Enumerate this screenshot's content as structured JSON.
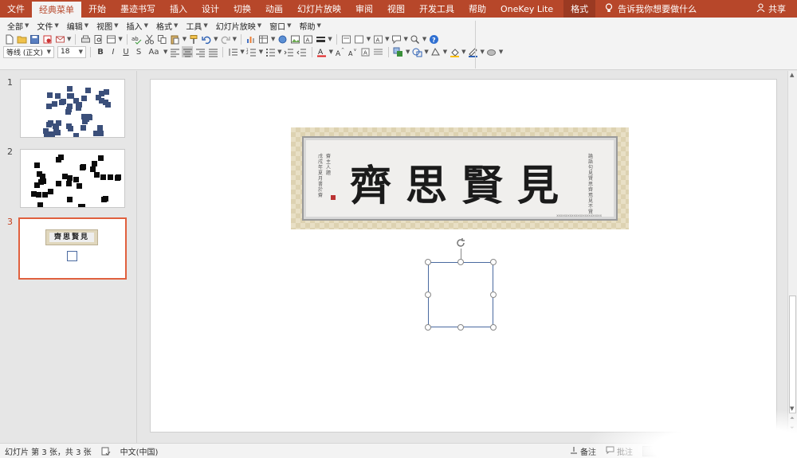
{
  "tabs": [
    "文件",
    "经典菜单",
    "开始",
    "墨迹书写",
    "插入",
    "设计",
    "切换",
    "动画",
    "幻灯片放映",
    "审阅",
    "视图",
    "开发工具",
    "帮助",
    "OneKey Lite"
  ],
  "active_tab_index": 1,
  "format_tab": "格式",
  "tell_me": "告诉我你想要做什么",
  "share_label": "共享",
  "menu": [
    "全部",
    "文件",
    "编辑",
    "视图",
    "插入",
    "格式",
    "工具",
    "幻灯片放映",
    "窗口",
    "帮助"
  ],
  "font_name": "等线 (正文)",
  "font_size": "18",
  "toolbar_letters": {
    "bold": "B",
    "italic": "I",
    "underline": "U",
    "strike": "S",
    "font_case": "Aa"
  },
  "thumbnails": [
    {
      "num": "1",
      "selected": false
    },
    {
      "num": "2",
      "selected": false
    },
    {
      "num": "3",
      "selected": true
    }
  ],
  "slide": {
    "calligraphy": "見賢思齊",
    "colophon_left": "戊戌年夏月書於齋",
    "colophon_right": "論語句見賢思齊焉見不賢",
    "credit": "xxxxxxxxxxxxxxxxxxxxxxxx"
  },
  "status": {
    "slide_info": "幻灯片 第 3 张，共 3 张",
    "language": "中文(中国)",
    "notes": "备注",
    "comments": "批注"
  },
  "colors": {
    "ribbon": "#b7472a",
    "selection": "#e0603e",
    "shape_border": "#4a6aa0"
  }
}
